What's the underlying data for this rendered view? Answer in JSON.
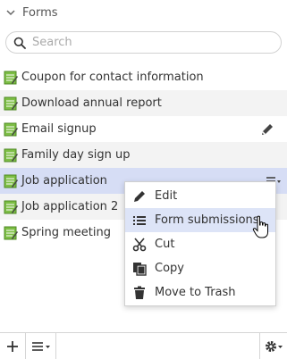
{
  "panel": {
    "title": "Forms"
  },
  "search": {
    "placeholder": "Search"
  },
  "forms": [
    {
      "label": "Coupon for contact information"
    },
    {
      "label": "Download annual report"
    },
    {
      "label": "Email signup"
    },
    {
      "label": "Family day sign up"
    },
    {
      "label": "Job application"
    },
    {
      "label": "Job application 2"
    },
    {
      "label": "Spring meeting"
    }
  ],
  "context_menu": {
    "items": [
      {
        "label": "Edit",
        "icon": "pencil-icon"
      },
      {
        "label": "Form submissions",
        "icon": "list-icon"
      },
      {
        "label": "Cut",
        "icon": "scissors-icon"
      },
      {
        "label": "Copy",
        "icon": "copy-icon"
      },
      {
        "label": "Move to Trash",
        "icon": "trash-icon"
      }
    ]
  },
  "colors": {
    "selected_row": "#d6ddf5",
    "alt_row": "#f3f3f3",
    "menu_highlight": "#dde4f7",
    "form_icon_green": "#6bb33b"
  }
}
